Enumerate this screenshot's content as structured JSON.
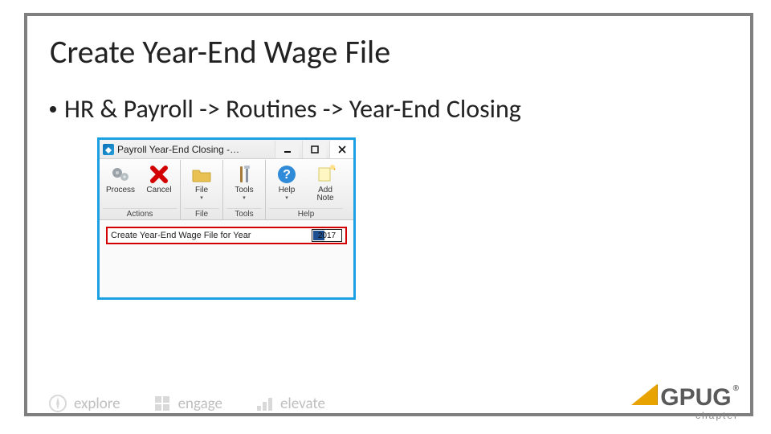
{
  "slide": {
    "title": "Create Year-End Wage File",
    "bullet": "HR & Payroll -> Routines -> Year-End Closing"
  },
  "window": {
    "title": "Payroll Year-End Closing -…",
    "toolbar": {
      "process": "Process",
      "cancel": "Cancel",
      "file": "File",
      "tools": "Tools",
      "help": "Help",
      "addnote": "Add Note"
    },
    "groups": {
      "actions": "Actions",
      "file": "File",
      "tools": "Tools",
      "help": "Help"
    },
    "field_label": "Create Year-End Wage File for Year",
    "year_value": "2017"
  },
  "footer": {
    "explore": "explore",
    "engage": "engage",
    "elevate": "elevate"
  },
  "brand": {
    "name": "GPUG",
    "reg": "®",
    "sub": "chapter"
  }
}
